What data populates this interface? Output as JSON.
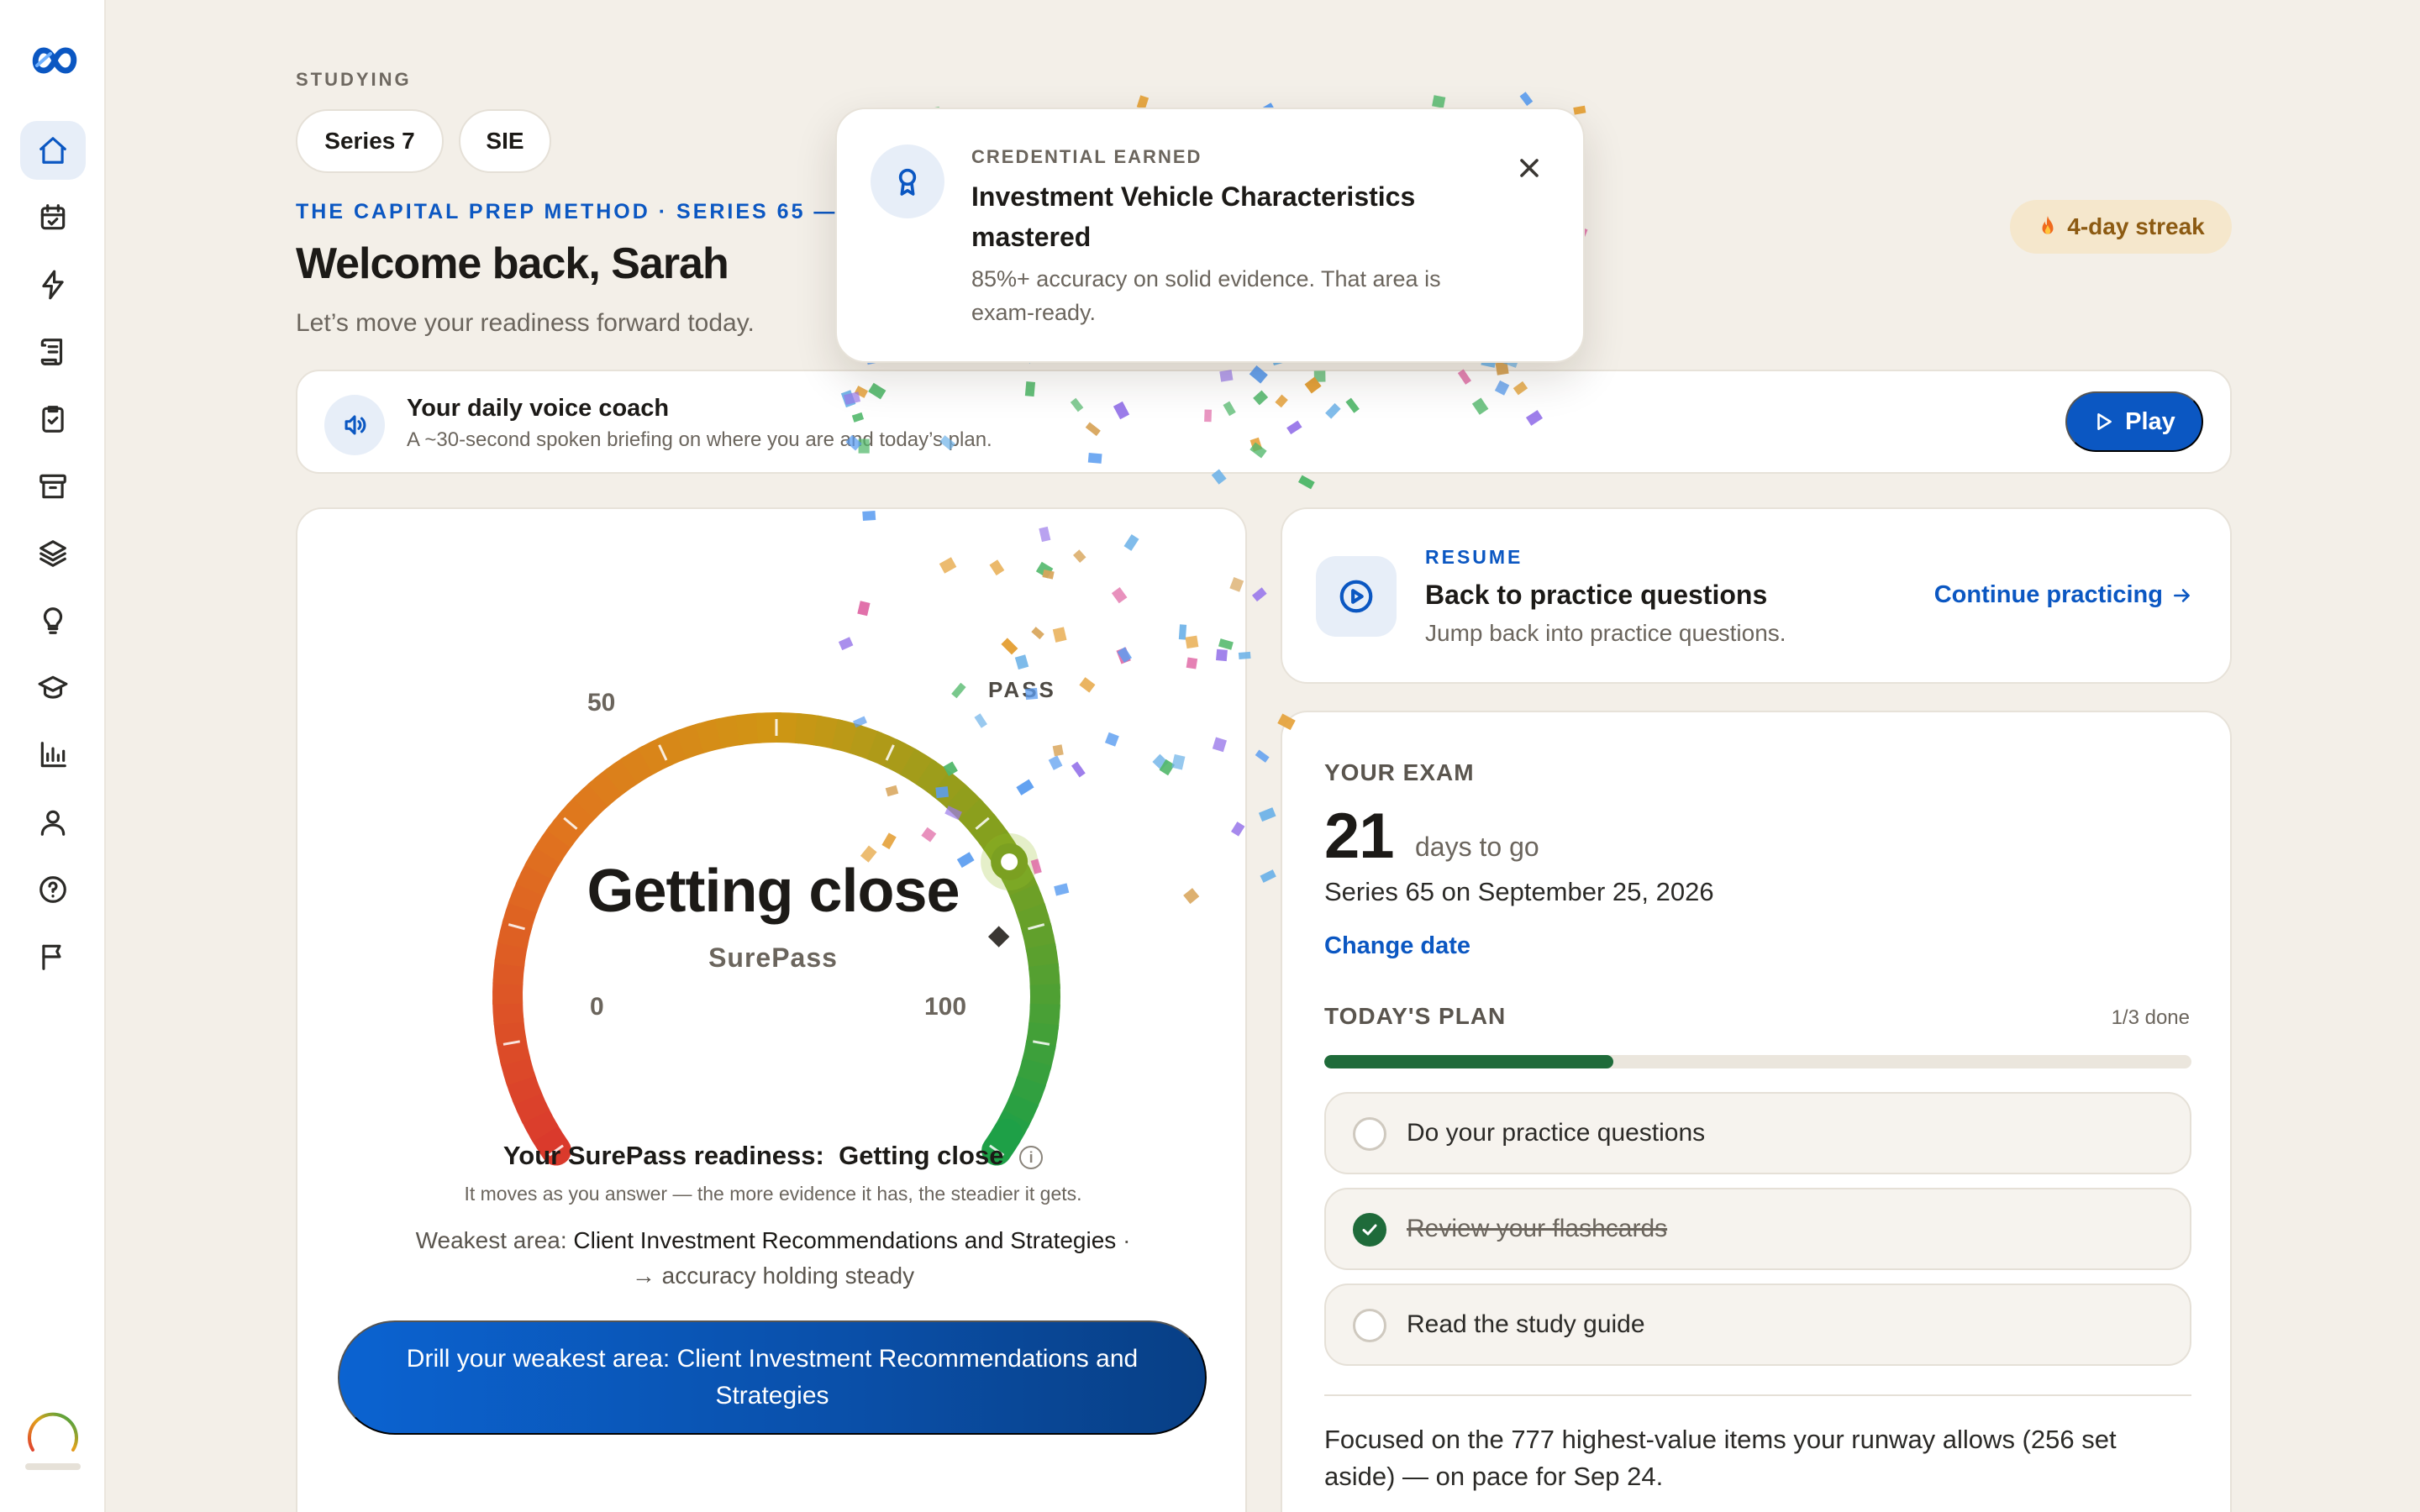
{
  "sidebar": {
    "logo": "infinity-logo",
    "items": [
      {
        "name": "home-icon",
        "active": true
      },
      {
        "name": "calendar-check-icon"
      },
      {
        "name": "lightning-icon"
      },
      {
        "name": "scroll-icon"
      },
      {
        "name": "clipboard-check-icon"
      },
      {
        "name": "archive-icon"
      },
      {
        "name": "layers-icon"
      },
      {
        "name": "lightbulb-icon"
      },
      {
        "name": "graduation-cap-icon"
      },
      {
        "name": "bar-chart-icon"
      },
      {
        "name": "user-icon"
      },
      {
        "name": "help-circle-icon"
      },
      {
        "name": "flag-icon"
      }
    ]
  },
  "header": {
    "studying_label": "STUDYING",
    "exams": [
      "Series 7",
      "SIE"
    ],
    "method": "THE CAPITAL PREP METHOD · SERIES 65 — ",
    "welcome": "Welcome back, Sarah",
    "subtitle": "Let’s move your readiness forward today.",
    "streak": "4-day streak",
    "streak_icon": "fire-icon"
  },
  "voice_coach": {
    "title": "Your daily voice coach",
    "subtitle": "A ~30-second spoken briefing on where you are and today’s plan.",
    "play_label": "Play"
  },
  "readiness": {
    "gauge_status": "Getting close",
    "brand": "SurePass",
    "tick_min": "0",
    "tick_mid": "50",
    "tick_max": "100",
    "pass_label": "PASS",
    "score_fraction": 0.74,
    "pass_fraction": 0.8,
    "line_prefix": "Your SurePass readiness:",
    "line_status": "Getting close",
    "info_icon": "i",
    "explanation": "It moves as you answer — the more evidence it has, the steadier it gets.",
    "weak_prefix": "Weakest area:",
    "weak_area": "Client Investment Recommendations and Strategies",
    "weak_sep": "·",
    "weak_trend": "→ accuracy holding steady",
    "drill_button": "Drill your weakest area: Client Investment Recommendations and Strategies"
  },
  "resume": {
    "label": "RESUME",
    "title": "Back to practice questions",
    "subtitle": "Jump back into practice questions.",
    "link": "Continue practicing"
  },
  "exam": {
    "label": "YOUR EXAM",
    "days": "21",
    "days_suffix": "days to go",
    "date_line": "Series 65 on September 25, 2026",
    "change_date": "Change date",
    "plan_label": "TODAY'S PLAN",
    "plan_count": "1/3 done",
    "progress_fraction": 0.333,
    "tasks": [
      {
        "label": "Do your practice questions",
        "done": false
      },
      {
        "label": "Review your flashcards",
        "done": true
      },
      {
        "label": "Read the study guide",
        "done": false
      }
    ],
    "focus_text": "Focused on the 777 highest-value items your runway allows (256 set aside) — on pace for Sep 24."
  },
  "toast": {
    "label": "CREDENTIAL EARNED",
    "title": "Investment Vehicle Characteristics mastered",
    "body": "85%+ accuracy on solid evidence. That area is exam-ready."
  },
  "colors": {
    "accent": "#0b57c2",
    "success": "#1f6b3a",
    "background": "#f3efe8",
    "streak_bg": "#f5e7cc",
    "streak_text": "#8c5a12"
  }
}
